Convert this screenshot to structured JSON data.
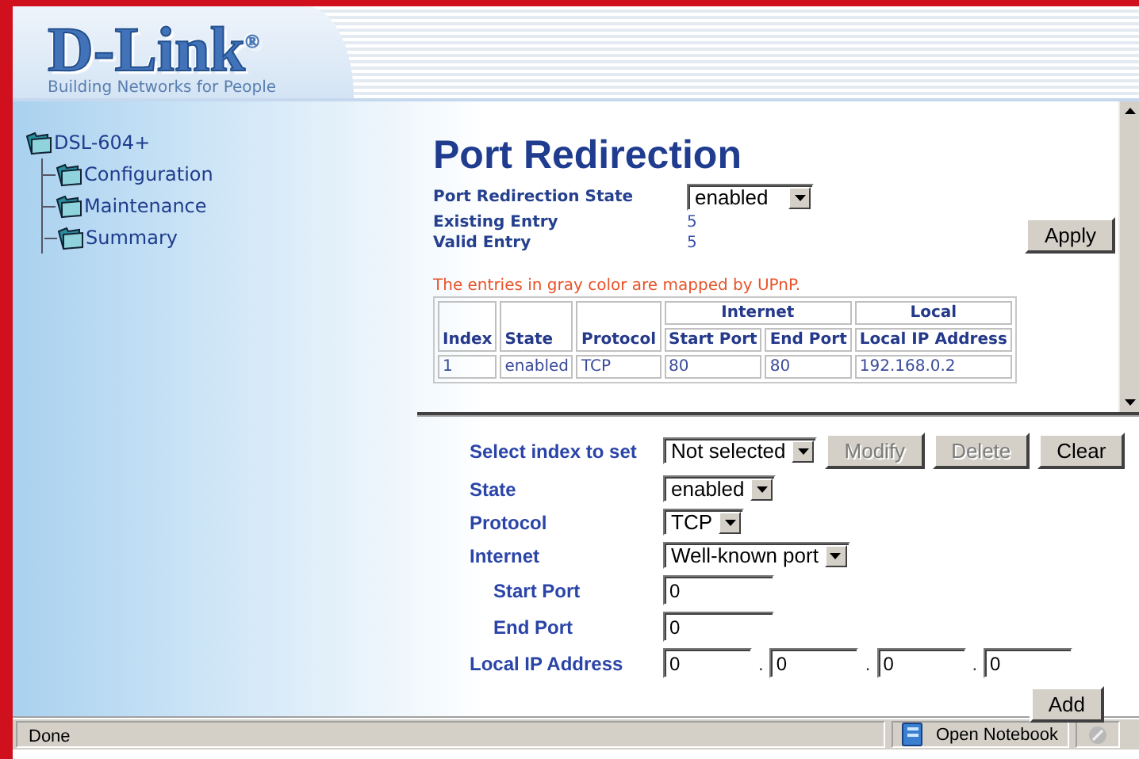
{
  "logo": {
    "text": "D-Link",
    "mark": "®",
    "tagline": "Building Networks for People"
  },
  "tree": {
    "label": "DSL-604+",
    "children": [
      {
        "label": "Configuration"
      },
      {
        "label": "Maintenance"
      },
      {
        "label": "Summary"
      }
    ]
  },
  "page": {
    "title": "Port Redirection",
    "fields": [
      {
        "kind": "select",
        "label": "Port Redirection State",
        "value": "enabled"
      },
      {
        "kind": "text",
        "label": "Existing Entry",
        "value": "5"
      },
      {
        "kind": "text",
        "label": "Valid Entry",
        "value": "5"
      }
    ],
    "apply": "Apply",
    "note": "The entries in gray color are mapped by UPnP.",
    "table": {
      "header_rows": [
        [
          {
            "label": "Index",
            "rowspan": 2
          },
          {
            "label": "State",
            "rowspan": 2
          },
          {
            "label": "Protocol",
            "rowspan": 2
          },
          {
            "label": "Internet",
            "colspan": 2
          },
          {
            "label": "Local"
          }
        ],
        [
          {
            "label": "Start Port"
          },
          {
            "label": "End Port"
          },
          {
            "label": "Local IP Address"
          }
        ]
      ],
      "rows": [
        [
          "1",
          "enabled",
          "TCP",
          "80",
          "80",
          "192.168.0.2"
        ]
      ]
    }
  },
  "form": {
    "rows": [
      {
        "kind": "select",
        "label": "Select index to set",
        "value": "Not selected",
        "indented": false,
        "buttons": [
          {
            "label": "Modify",
            "disabled": true
          },
          {
            "label": "Delete",
            "disabled": true
          },
          {
            "label": "Clear",
            "disabled": false
          }
        ]
      },
      {
        "kind": "select",
        "label": "State",
        "value": "enabled",
        "indented": false
      },
      {
        "kind": "select",
        "label": "Protocol",
        "value": "TCP",
        "indented": false
      },
      {
        "kind": "select",
        "label": "Internet",
        "value": "Well-known port",
        "indented": false
      },
      {
        "kind": "input",
        "label": "Start Port",
        "value": "0",
        "indented": true
      },
      {
        "kind": "input",
        "label": "End Port",
        "value": "0",
        "indented": true
      },
      {
        "kind": "ip",
        "label": "Local IP Address",
        "octets": [
          "0",
          "0",
          "0",
          "0"
        ],
        "separators": [
          ".",
          ".",
          "."
        ],
        "indented": false
      }
    ],
    "add": "Add"
  },
  "status_bar": {
    "text": "Done",
    "notebook": "Open Notebook"
  }
}
